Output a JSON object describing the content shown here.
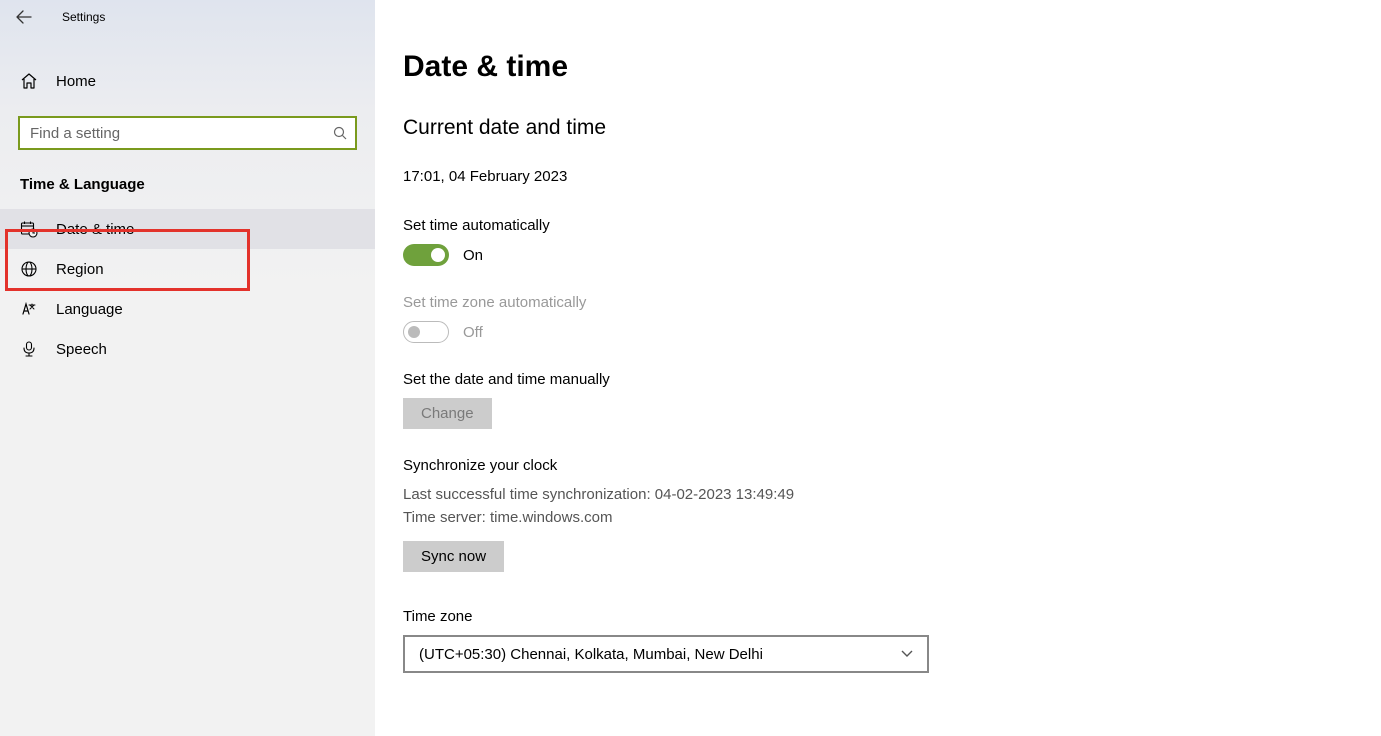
{
  "titlebar": {
    "title": "Settings"
  },
  "sidebar": {
    "home_label": "Home",
    "search_placeholder": "Find a setting",
    "category_label": "Time & Language",
    "items": [
      {
        "label": "Date & time"
      },
      {
        "label": "Region"
      },
      {
        "label": "Language"
      },
      {
        "label": "Speech"
      }
    ]
  },
  "main": {
    "title": "Date & time",
    "section_current": "Current date and time",
    "datetime": "17:01, 04 February 2023",
    "set_time_auto_label": "Set time automatically",
    "set_time_auto_state": "On",
    "set_tz_auto_label": "Set time zone automatically",
    "set_tz_auto_state": "Off",
    "manual_label": "Set the date and time manually",
    "change_btn": "Change",
    "sync_title": "Synchronize your clock",
    "sync_last": "Last successful time synchronization: 04-02-2023 13:49:49",
    "sync_server": "Time server: time.windows.com",
    "sync_btn": "Sync now",
    "tz_label": "Time zone",
    "tz_value": "(UTC+05:30) Chennai, Kolkata, Mumbai, New Delhi"
  }
}
